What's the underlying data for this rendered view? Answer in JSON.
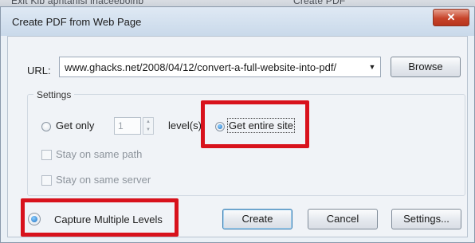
{
  "background_strip": {
    "left_text": "Exit Kib apntanisi iriaceeboinb",
    "right_text": "Create PDF"
  },
  "dialog": {
    "title": "Create PDF from Web Page",
    "close_glyph": "✕"
  },
  "url": {
    "label": "URL:",
    "value": "www.ghacks.net/2008/04/12/convert-a-full-website-into-pdf/",
    "dropdown_glyph": "▼"
  },
  "browse_label": "Browse",
  "settings": {
    "legend": "Settings",
    "get_only_label": "Get only",
    "levels_value": "1",
    "levels_label": "level(s)",
    "get_entire_site_label": "Get entire site",
    "selected_mode": "get-entire-site",
    "stay_same_path_label": "Stay on same path",
    "stay_same_server_label": "Stay on same server",
    "stay_same_path_checked": false,
    "stay_same_server_checked": false
  },
  "capture_multiple_levels": {
    "label": "Capture Multiple Levels",
    "selected": true
  },
  "buttons": {
    "create": "Create",
    "cancel": "Cancel",
    "settings": "Settings..."
  },
  "spinner_glyphs": {
    "up": "▲",
    "down": "▼"
  },
  "colors": {
    "highlight": "#d8121c",
    "close_button": "#c7442a",
    "radio_selected": "#1a6fc2"
  }
}
